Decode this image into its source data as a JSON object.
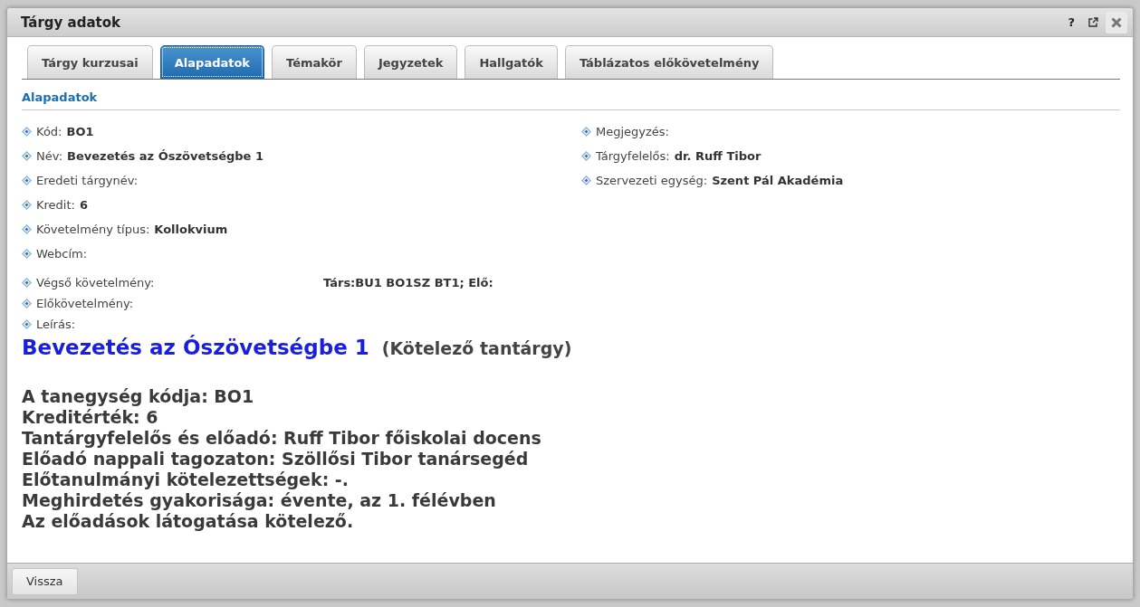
{
  "window": {
    "title": "Tárgy adatok",
    "controls": [
      "?"
    ]
  },
  "tabs": [
    {
      "label": "Tárgy kurzusai",
      "selected": false
    },
    {
      "label": "Alapadatok",
      "selected": true
    },
    {
      "label": "Témakör",
      "selected": false
    },
    {
      "label": "Jegyzetek",
      "selected": false
    },
    {
      "label": "Hallgatók",
      "selected": false
    },
    {
      "label": "Táblázatos előkövetelmény",
      "selected": false
    }
  ],
  "section_title": "Alapadatok",
  "fields_left": [
    {
      "label": "Kód:",
      "value": "BO1",
      "kind": "inline"
    },
    {
      "label": "Név:",
      "value": "Bevezetés az Ószövetségbe 1",
      "kind": "inline"
    },
    {
      "label": "Eredeti tárgynév:",
      "kind": "inline"
    },
    {
      "label": "Kredit:",
      "value": "6",
      "kind": "inline"
    },
    {
      "label": "Követelmény típus:",
      "value": "Kollokvium",
      "kind": "inline"
    },
    {
      "label": "Webcím:",
      "kind": "inline"
    }
  ],
  "fields_right": [
    {
      "label": "Megjegyzés:",
      "kind": "inline"
    },
    {
      "label": "Tárgyfelelős:",
      "value": "dr. Ruff Tibor",
      "kind": "inline"
    },
    {
      "label": "Szervezeti egység:",
      "value": "Szent Pál Akadémia",
      "kind": "inline"
    }
  ],
  "fields_lower": [
    {
      "label": "Végső követelmény:",
      "value": "Társ:BU1 BO1SZ BT1; Elő:",
      "kind": "column"
    },
    {
      "label": "Előkövetelmény:",
      "kind": "column"
    },
    {
      "label": "Leírás:",
      "kind": "column"
    }
  ],
  "description": {
    "title": "Bevezetés az Ószövetségbe 1",
    "subtitle": "(Kötelező tantárgy)",
    "lines": [
      "A tanegység kódja: BO1",
      "Kreditérték: 6",
      "Tantárgyfelelős és előadó: Ruff Tibor főiskolai docens",
      "Előadó nappali tagozaton: Szöllősi Tibor tanársegéd",
      "Előtanulmányi kötelezettségek: -.",
      "Meghirdetés gyakorisága: évente, az 1. félévben",
      "Az előadások látogatása kötelező."
    ]
  },
  "footer": {
    "buttons": [
      "Vissza"
    ]
  }
}
